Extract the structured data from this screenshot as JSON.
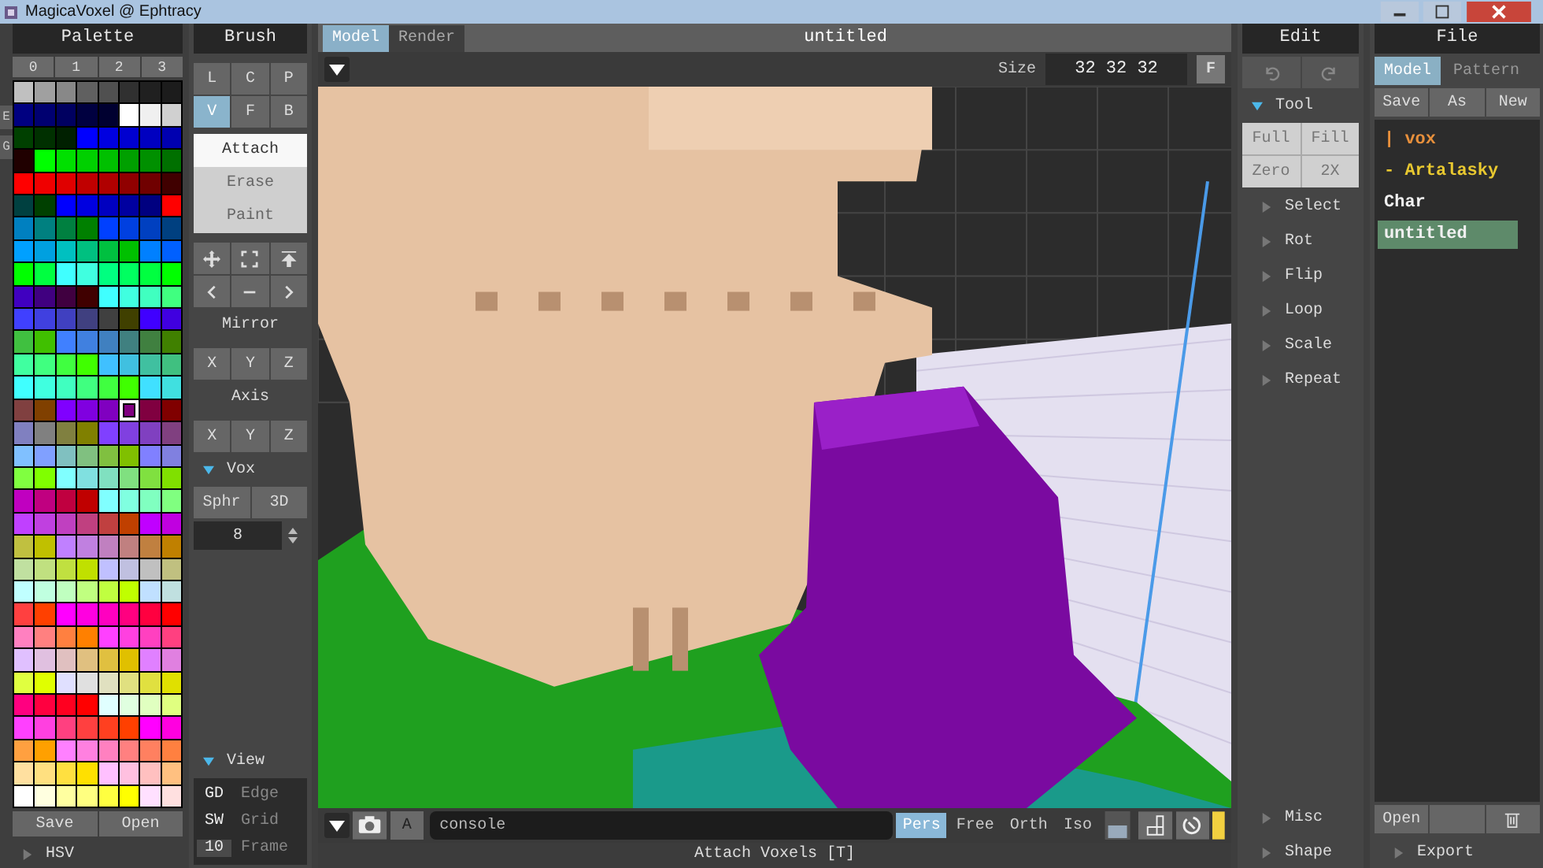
{
  "window": {
    "title": "MagicaVoxel @ Ephtracy"
  },
  "side_tabs": [
    "E",
    "G"
  ],
  "palette": {
    "title": "Palette",
    "pages": [
      "0",
      "1",
      "2",
      "3"
    ],
    "rows": [
      [
        {
          "color": "#c0c0c0",
          "selected": false
        },
        {
          "color": "#a0a0a0",
          "selected": false
        },
        {
          "color": "#888888",
          "selected": false
        },
        {
          "color": "#606060",
          "selected": false
        },
        {
          "color": "#505050",
          "selected": false
        },
        {
          "color": "#303030",
          "selected": false
        },
        {
          "color": "#202020",
          "selected": false
        },
        {
          "color": "#1c1c1c",
          "selected": false
        }
      ],
      [
        {
          "color": "#000080",
          "selected": false
        },
        {
          "color": "#000070",
          "selected": false
        },
        {
          "color": "#000060",
          "selected": false
        },
        {
          "color": "#000040",
          "selected": false
        },
        {
          "color": "#000030",
          "selected": false
        },
        {
          "color": "#ffffff",
          "selected": false
        },
        {
          "color": "#f0f0f0",
          "selected": false
        },
        {
          "color": "#d0d0d0",
          "selected": false
        }
      ],
      [
        {
          "color": "#004000",
          "selected": false
        },
        {
          "color": "#003000",
          "selected": false
        },
        {
          "color": "#002000",
          "selected": false
        },
        {
          "color": "#0000ff",
          "selected": false
        },
        {
          "color": "#0000e0",
          "selected": false
        },
        {
          "color": "#0000d0",
          "selected": false
        },
        {
          "color": "#0000c0",
          "selected": false
        },
        {
          "color": "#0000b0",
          "selected": false
        }
      ],
      [
        {
          "color": "#200000",
          "selected": false
        },
        {
          "color": "#00ff00",
          "selected": false
        },
        {
          "color": "#00e000",
          "selected": false
        },
        {
          "color": "#00d000",
          "selected": false
        },
        {
          "color": "#00c000",
          "selected": false
        },
        {
          "color": "#00a000",
          "selected": false
        },
        {
          "color": "#009000",
          "selected": false
        },
        {
          "color": "#007000",
          "selected": false
        }
      ],
      [
        {
          "color": "#ff0000",
          "selected": false
        },
        {
          "color": "#f00000",
          "selected": false
        },
        {
          "color": "#e00000",
          "selected": false
        },
        {
          "color": "#c00000",
          "selected": false
        },
        {
          "color": "#b00000",
          "selected": false
        },
        {
          "color": "#900000",
          "selected": false
        },
        {
          "color": "#700000",
          "selected": false
        },
        {
          "color": "#400000",
          "selected": false
        }
      ],
      [
        {
          "color": "#004040",
          "selected": false
        },
        {
          "color": "#004000",
          "selected": false
        },
        {
          "color": "#0000ff",
          "selected": false
        },
        {
          "color": "#0000e0",
          "selected": false
        },
        {
          "color": "#0000c0",
          "selected": false
        },
        {
          "color": "#0000a0",
          "selected": false
        },
        {
          "color": "#000080",
          "selected": false
        },
        {
          "color": "#ff0000",
          "selected": false
        }
      ],
      [
        {
          "color": "#0080c0",
          "selected": false
        },
        {
          "color": "#008080",
          "selected": false
        },
        {
          "color": "#008040",
          "selected": false
        },
        {
          "color": "#008000",
          "selected": false
        },
        {
          "color": "#0040ff",
          "selected": false
        },
        {
          "color": "#0040e0",
          "selected": false
        },
        {
          "color": "#0040c0",
          "selected": false
        },
        {
          "color": "#004080",
          "selected": false
        }
      ],
      [
        {
          "color": "#00a0ff",
          "selected": false
        },
        {
          "color": "#00a0e0",
          "selected": false
        },
        {
          "color": "#00c0c0",
          "selected": false
        },
        {
          "color": "#00c080",
          "selected": false
        },
        {
          "color": "#00c040",
          "selected": false
        },
        {
          "color": "#00c000",
          "selected": false
        },
        {
          "color": "#0080ff",
          "selected": false
        },
        {
          "color": "#0060ff",
          "selected": false
        }
      ],
      [
        {
          "color": "#00ff00",
          "selected": false
        },
        {
          "color": "#00ff40",
          "selected": false
        },
        {
          "color": "#40ffff",
          "selected": false
        },
        {
          "color": "#40ffe0",
          "selected": false
        },
        {
          "color": "#00ff80",
          "selected": false
        },
        {
          "color": "#00ff60",
          "selected": false
        },
        {
          "color": "#00ff40",
          "selected": false
        },
        {
          "color": "#00ff00",
          "selected": false
        }
      ],
      [
        {
          "color": "#4000c0",
          "selected": false
        },
        {
          "color": "#400080",
          "selected": false
        },
        {
          "color": "#400040",
          "selected": false
        },
        {
          "color": "#400000",
          "selected": false
        },
        {
          "color": "#40ffff",
          "selected": false
        },
        {
          "color": "#40ffe0",
          "selected": false
        },
        {
          "color": "#40ffc0",
          "selected": false
        },
        {
          "color": "#40ff80",
          "selected": false
        }
      ],
      [
        {
          "color": "#4040ff",
          "selected": false
        },
        {
          "color": "#4040e0",
          "selected": false
        },
        {
          "color": "#4040c0",
          "selected": false
        },
        {
          "color": "#404080",
          "selected": false
        },
        {
          "color": "#404040",
          "selected": false
        },
        {
          "color": "#404000",
          "selected": false
        },
        {
          "color": "#4000ff",
          "selected": false
        },
        {
          "color": "#4000e0",
          "selected": false
        }
      ],
      [
        {
          "color": "#40c040",
          "selected": false
        },
        {
          "color": "#40c000",
          "selected": false
        },
        {
          "color": "#4080ff",
          "selected": false
        },
        {
          "color": "#4080e0",
          "selected": false
        },
        {
          "color": "#4080c0",
          "selected": false
        },
        {
          "color": "#408080",
          "selected": false
        },
        {
          "color": "#408040",
          "selected": false
        },
        {
          "color": "#408000",
          "selected": false
        }
      ],
      [
        {
          "color": "#40ffa0",
          "selected": false
        },
        {
          "color": "#40ff80",
          "selected": false
        },
        {
          "color": "#40ff40",
          "selected": false
        },
        {
          "color": "#40ff00",
          "selected": false
        },
        {
          "color": "#40c0ff",
          "selected": false
        },
        {
          "color": "#40c0e0",
          "selected": false
        },
        {
          "color": "#40c0a0",
          "selected": false
        },
        {
          "color": "#40c080",
          "selected": false
        }
      ],
      [
        {
          "color": "#40ffff",
          "selected": false
        },
        {
          "color": "#40ffe0",
          "selected": false
        },
        {
          "color": "#40ffc0",
          "selected": false
        },
        {
          "color": "#40ff80",
          "selected": false
        },
        {
          "color": "#40ff40",
          "selected": false
        },
        {
          "color": "#40ff00",
          "selected": false
        },
        {
          "color": "#40e0ff",
          "selected": false
        },
        {
          "color": "#40e0e0",
          "selected": false
        }
      ],
      [
        {
          "color": "#804040",
          "selected": false
        },
        {
          "color": "#804000",
          "selected": false
        },
        {
          "color": "#8000ff",
          "selected": false
        },
        {
          "color": "#8000e0",
          "selected": false
        },
        {
          "color": "#8000c0",
          "selected": false
        },
        {
          "color": "#800080",
          "selected": true
        },
        {
          "color": "#800040",
          "selected": false
        },
        {
          "color": "#800000",
          "selected": false
        }
      ],
      [
        {
          "color": "#8080c0",
          "selected": false
        },
        {
          "color": "#808080",
          "selected": false
        },
        {
          "color": "#808040",
          "selected": false
        },
        {
          "color": "#808000",
          "selected": false
        },
        {
          "color": "#8040ff",
          "selected": false
        },
        {
          "color": "#8040e0",
          "selected": false
        },
        {
          "color": "#8040c0",
          "selected": false
        },
        {
          "color": "#804080",
          "selected": false
        }
      ],
      [
        {
          "color": "#80c0ff",
          "selected": false
        },
        {
          "color": "#80a0ff",
          "selected": false
        },
        {
          "color": "#80c0c0",
          "selected": false
        },
        {
          "color": "#80c080",
          "selected": false
        },
        {
          "color": "#80c040",
          "selected": false
        },
        {
          "color": "#80c000",
          "selected": false
        },
        {
          "color": "#8080ff",
          "selected": false
        },
        {
          "color": "#8080e0",
          "selected": false
        }
      ],
      [
        {
          "color": "#80ff40",
          "selected": false
        },
        {
          "color": "#80ff00",
          "selected": false
        },
        {
          "color": "#80ffff",
          "selected": false
        },
        {
          "color": "#80e0e0",
          "selected": false
        },
        {
          "color": "#80e0c0",
          "selected": false
        },
        {
          "color": "#80e080",
          "selected": false
        },
        {
          "color": "#80e040",
          "selected": false
        },
        {
          "color": "#80e000",
          "selected": false
        }
      ],
      [
        {
          "color": "#c000c0",
          "selected": false
        },
        {
          "color": "#c00080",
          "selected": false
        },
        {
          "color": "#c00040",
          "selected": false
        },
        {
          "color": "#c00000",
          "selected": false
        },
        {
          "color": "#80ffff",
          "selected": false
        },
        {
          "color": "#80ffe0",
          "selected": false
        },
        {
          "color": "#80ffc0",
          "selected": false
        },
        {
          "color": "#80ff80",
          "selected": false
        }
      ],
      [
        {
          "color": "#c040ff",
          "selected": false
        },
        {
          "color": "#c040e0",
          "selected": false
        },
        {
          "color": "#c040c0",
          "selected": false
        },
        {
          "color": "#c04080",
          "selected": false
        },
        {
          "color": "#c04040",
          "selected": false
        },
        {
          "color": "#c04000",
          "selected": false
        },
        {
          "color": "#c000ff",
          "selected": false
        },
        {
          "color": "#c000e0",
          "selected": false
        }
      ],
      [
        {
          "color": "#c0c040",
          "selected": false
        },
        {
          "color": "#c0c000",
          "selected": false
        },
        {
          "color": "#c080ff",
          "selected": false
        },
        {
          "color": "#c080e0",
          "selected": false
        },
        {
          "color": "#c080c0",
          "selected": false
        },
        {
          "color": "#c08080",
          "selected": false
        },
        {
          "color": "#c08040",
          "selected": false
        },
        {
          "color": "#c08000",
          "selected": false
        }
      ],
      [
        {
          "color": "#c0e0a0",
          "selected": false
        },
        {
          "color": "#c0e080",
          "selected": false
        },
        {
          "color": "#c0e040",
          "selected": false
        },
        {
          "color": "#c0e000",
          "selected": false
        },
        {
          "color": "#c0c0ff",
          "selected": false
        },
        {
          "color": "#c0c0e0",
          "selected": false
        },
        {
          "color": "#c0c0c0",
          "selected": false
        },
        {
          "color": "#c0c080",
          "selected": false
        }
      ],
      [
        {
          "color": "#c0ffff",
          "selected": false
        },
        {
          "color": "#c0ffe0",
          "selected": false
        },
        {
          "color": "#c0ffc0",
          "selected": false
        },
        {
          "color": "#c0ff80",
          "selected": false
        },
        {
          "color": "#c0ff40",
          "selected": false
        },
        {
          "color": "#c0ff00",
          "selected": false
        },
        {
          "color": "#c0e0ff",
          "selected": false
        },
        {
          "color": "#c0e0e0",
          "selected": false
        }
      ],
      [
        {
          "color": "#ff4040",
          "selected": false
        },
        {
          "color": "#ff4000",
          "selected": false
        },
        {
          "color": "#ff00ff",
          "selected": false
        },
        {
          "color": "#ff00e0",
          "selected": false
        },
        {
          "color": "#ff00c0",
          "selected": false
        },
        {
          "color": "#ff0080",
          "selected": false
        },
        {
          "color": "#ff0040",
          "selected": false
        },
        {
          "color": "#ff0000",
          "selected": false
        }
      ],
      [
        {
          "color": "#ff80c0",
          "selected": false
        },
        {
          "color": "#ff8080",
          "selected": false
        },
        {
          "color": "#ff8040",
          "selected": false
        },
        {
          "color": "#ff8000",
          "selected": false
        },
        {
          "color": "#ff40ff",
          "selected": false
        },
        {
          "color": "#ff40e0",
          "selected": false
        },
        {
          "color": "#ff40c0",
          "selected": false
        },
        {
          "color": "#ff4080",
          "selected": false
        }
      ],
      [
        {
          "color": "#e0c0ff",
          "selected": false
        },
        {
          "color": "#e0c0e0",
          "selected": false
        },
        {
          "color": "#e0c0c0",
          "selected": false
        },
        {
          "color": "#e0c080",
          "selected": false
        },
        {
          "color": "#e0c040",
          "selected": false
        },
        {
          "color": "#e0c000",
          "selected": false
        },
        {
          "color": "#e080ff",
          "selected": false
        },
        {
          "color": "#e080e0",
          "selected": false
        }
      ],
      [
        {
          "color": "#e0ff40",
          "selected": false
        },
        {
          "color": "#e0ff00",
          "selected": false
        },
        {
          "color": "#e0e0ff",
          "selected": false
        },
        {
          "color": "#e0e0e0",
          "selected": false
        },
        {
          "color": "#e0e0c0",
          "selected": false
        },
        {
          "color": "#e0e080",
          "selected": false
        },
        {
          "color": "#e0e040",
          "selected": false
        },
        {
          "color": "#e0e000",
          "selected": false
        }
      ],
      [
        {
          "color": "#ff0080",
          "selected": false
        },
        {
          "color": "#ff0040",
          "selected": false
        },
        {
          "color": "#ff0020",
          "selected": false
        },
        {
          "color": "#ff0000",
          "selected": false
        },
        {
          "color": "#e0ffff",
          "selected": false
        },
        {
          "color": "#e0ffe0",
          "selected": false
        },
        {
          "color": "#e0ffc0",
          "selected": false
        },
        {
          "color": "#e0ff80",
          "selected": false
        }
      ],
      [
        {
          "color": "#ff40ff",
          "selected": false
        },
        {
          "color": "#ff40e0",
          "selected": false
        },
        {
          "color": "#ff4080",
          "selected": false
        },
        {
          "color": "#ff4040",
          "selected": false
        },
        {
          "color": "#ff4020",
          "selected": false
        },
        {
          "color": "#ff4000",
          "selected": false
        },
        {
          "color": "#ff00ff",
          "selected": false
        },
        {
          "color": "#ff00e0",
          "selected": false
        }
      ],
      [
        {
          "color": "#ffa040",
          "selected": false
        },
        {
          "color": "#ffa000",
          "selected": false
        },
        {
          "color": "#ff80ff",
          "selected": false
        },
        {
          "color": "#ff80e0",
          "selected": false
        },
        {
          "color": "#ff80c0",
          "selected": false
        },
        {
          "color": "#ff8080",
          "selected": false
        },
        {
          "color": "#ff8060",
          "selected": false
        },
        {
          "color": "#ff8040",
          "selected": false
        }
      ],
      [
        {
          "color": "#ffe0a0",
          "selected": false
        },
        {
          "color": "#ffe080",
          "selected": false
        },
        {
          "color": "#ffe040",
          "selected": false
        },
        {
          "color": "#ffe000",
          "selected": false
        },
        {
          "color": "#ffc0ff",
          "selected": false
        },
        {
          "color": "#ffc0e0",
          "selected": false
        },
        {
          "color": "#ffc0c0",
          "selected": false
        },
        {
          "color": "#ffc080",
          "selected": false
        }
      ],
      [
        {
          "color": "#ffffff",
          "selected": false
        },
        {
          "color": "#ffffe0",
          "selected": false
        },
        {
          "color": "#ffffa0",
          "selected": false
        },
        {
          "color": "#ffff80",
          "selected": false
        },
        {
          "color": "#ffff40",
          "selected": false
        },
        {
          "color": "#ffff00",
          "selected": false
        },
        {
          "color": "#ffe0ff",
          "selected": false
        },
        {
          "color": "#ffe0e0",
          "selected": false
        }
      ]
    ],
    "buttons": [
      "Save",
      "Open"
    ],
    "hsv": {
      "label": "HSV",
      "expanded": false
    }
  },
  "brush": {
    "title": "Brush",
    "modes": [
      {
        "label": "L",
        "selected": false
      },
      {
        "label": "C",
        "selected": false
      },
      {
        "label": "P",
        "selected": false
      },
      {
        "label": "V",
        "selected": true
      },
      {
        "label": "F",
        "selected": false
      },
      {
        "label": "B",
        "selected": false
      }
    ],
    "actions": [
      {
        "label": "Attach",
        "selected": true
      },
      {
        "label": "Erase",
        "selected": false
      },
      {
        "label": "Paint",
        "selected": false
      }
    ],
    "mirror": {
      "label": "Mirror",
      "axes": [
        "X",
        "Y",
        "Z"
      ]
    },
    "axis": {
      "label": "Axis",
      "axes": [
        "X",
        "Y",
        "Z"
      ]
    },
    "vox": {
      "label": "Vox",
      "expanded": true,
      "buttons": [
        "Sphr",
        "3D"
      ],
      "size": "8"
    },
    "view": {
      "label": "View",
      "expanded": true,
      "rows": [
        {
          "kind": "toggle",
          "key": "GD",
          "label": "Edge"
        },
        {
          "kind": "toggle",
          "key": "SW",
          "label": "Grid"
        },
        {
          "kind": "field",
          "key": "10",
          "label": "Frame"
        }
      ]
    }
  },
  "viewport": {
    "tabs": [
      {
        "label": "Model",
        "selected": true
      },
      {
        "label": "Render",
        "selected": false
      }
    ],
    "title": "untitled",
    "size_label": "Size",
    "size_value": "32 32 32",
    "fit_button": "F",
    "screenshot_button": "A",
    "console": {
      "placeholder": "console"
    },
    "projections": [
      {
        "label": "Pers",
        "selected": true
      },
      {
        "label": "Free",
        "selected": false
      },
      {
        "label": "Orth",
        "selected": false
      },
      {
        "label": "Iso",
        "selected": false
      }
    ],
    "status": "Attach Voxels [T]"
  },
  "edit": {
    "title": "Edit",
    "tool": {
      "label": "Tool",
      "expanded": true,
      "buttons": [
        "Full",
        "Fill",
        "Zero",
        "2X"
      ]
    },
    "sections": [
      {
        "label": "Select",
        "expanded": false
      },
      {
        "label": "Rot",
        "expanded": false
      },
      {
        "label": "Flip",
        "expanded": false
      },
      {
        "label": "Loop",
        "expanded": false
      },
      {
        "label": "Scale",
        "expanded": false
      },
      {
        "label": "Repeat",
        "expanded": false
      }
    ],
    "bottom_sections": [
      {
        "label": "Misc",
        "expanded": false
      },
      {
        "label": "Shape",
        "expanded": false
      }
    ]
  },
  "file": {
    "title": "File",
    "tabs": [
      {
        "label": "Model",
        "selected": true
      },
      {
        "label": "Pattern",
        "selected": false
      }
    ],
    "buttons": [
      "Save",
      "As",
      "New"
    ],
    "entries": [
      {
        "label": "| vox",
        "kind": "folder",
        "selected": false
      },
      {
        "label": "- Artalasky",
        "kind": "subfolder",
        "selected": false
      },
      {
        "label": "Char",
        "kind": "file",
        "selected": false
      },
      {
        "label": "untitled",
        "kind": "file",
        "selected": true
      }
    ],
    "open_button": "Open",
    "export": {
      "label": "Export",
      "expanded": false
    }
  }
}
